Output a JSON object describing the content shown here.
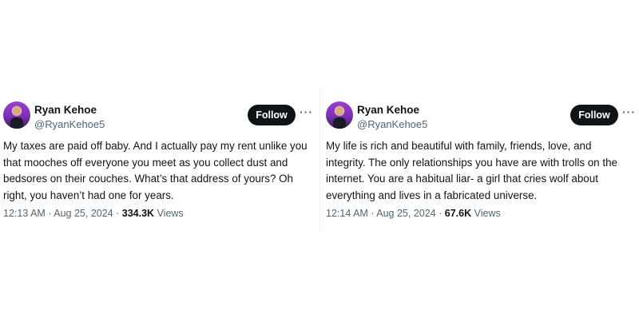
{
  "tweets": [
    {
      "author_name": "Ryan Kehoe",
      "author_handle": "@RyanKehoe5",
      "follow_label": "Follow",
      "more_label": "···",
      "text": "My taxes are paid off baby. And I actually pay my rent unlike you\nthat mooches off everyone you meet as you collect dust and\nbedsores on their couches. What’s that address of yours? Oh\nright, you haven’t had one for years.",
      "time": "12:13 AM",
      "date": "Aug 25, 2024",
      "views_count": "334.3K",
      "views_label": "Views"
    },
    {
      "author_name": "Ryan Kehoe",
      "author_handle": "@RyanKehoe5",
      "follow_label": "Follow",
      "more_label": "···",
      "text": "My life is rich and beautiful with family,  friends, love, and\nintegrity. The only relationships you have are with trolls on the\ninternet. You are a habitual  liar- a girl that cries wolf about\neverything and lives in a fabricated universe.",
      "time": "12:14 AM",
      "date": "Aug 25, 2024",
      "views_count": "67.6K",
      "views_label": "Views"
    }
  ]
}
